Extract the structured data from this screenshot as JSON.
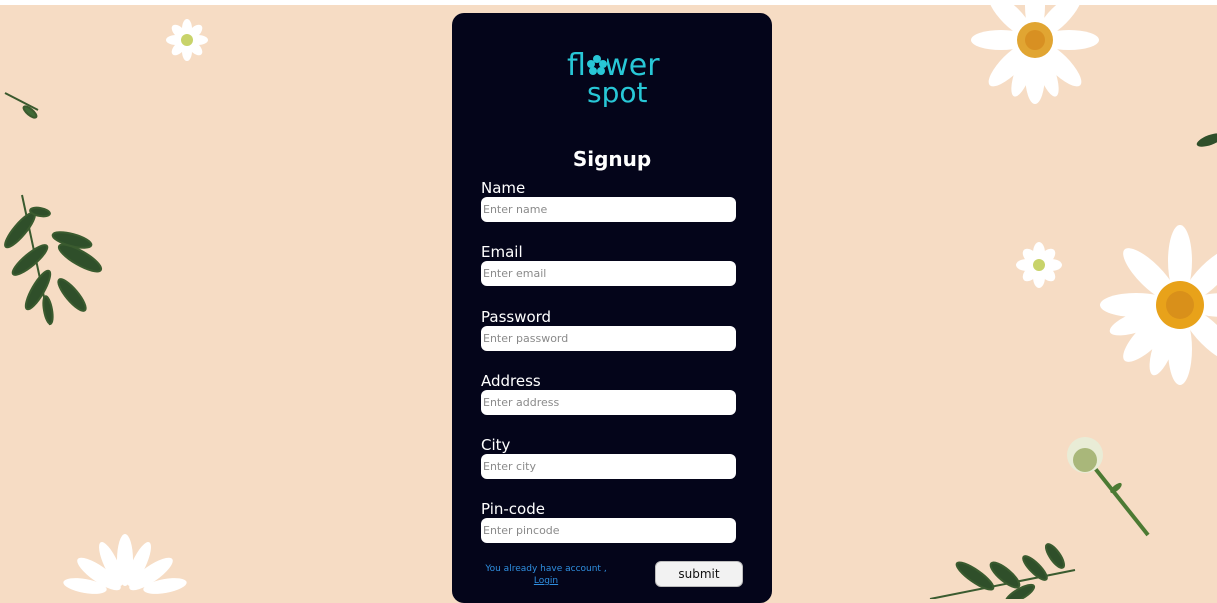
{
  "background": {
    "color": "#f6dcc4"
  },
  "card": {
    "color": "#04051a"
  },
  "logo": {
    "line1": "flower",
    "line2": "spot",
    "color": "#28c7d6"
  },
  "form": {
    "title": "Signup",
    "fields": [
      {
        "label": "Name",
        "placeholder": "Enter name"
      },
      {
        "label": "Email",
        "placeholder": "Enter email"
      },
      {
        "label": "Password",
        "placeholder": "Enter password"
      },
      {
        "label": "Address",
        "placeholder": "Enter address"
      },
      {
        "label": "City",
        "placeholder": "Enter city"
      },
      {
        "label": "Pin-code",
        "placeholder": "Enter pincode"
      }
    ],
    "already_text": "You already have account ,",
    "login_link": "Login",
    "submit_label": "submit"
  }
}
